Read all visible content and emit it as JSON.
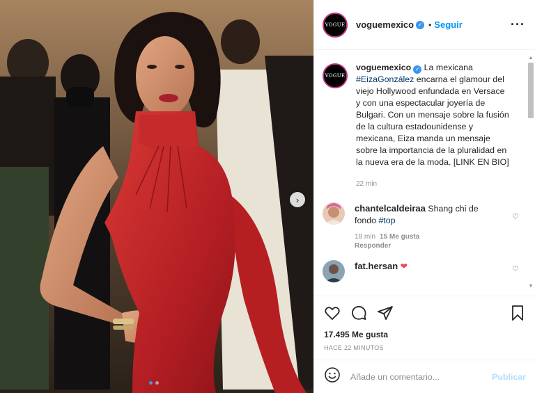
{
  "header": {
    "avatar_text": "VOGUE",
    "username": "voguemexico",
    "separator": "•",
    "follow_label": "Seguir",
    "more_label": "···"
  },
  "caption": {
    "username": "voguemexico",
    "text_before_tag": " La mexicana ",
    "tag": "#EizaGonzález",
    "text_after_tag": " encarna el glamour del viejo Hollywood enfundada en Versace y con una espectacular joyería de Bulgari. Con un mensaje sobre la fusión de la cultura estadounidense y mexicana, Eiza manda un mensaje sobre la importancia de la pluralidad en la nueva era de la moda. [LINK EN BIO]",
    "time": "22 min"
  },
  "comments": [
    {
      "username": "chantelcaldeiraa",
      "text": " Shang chi de fondo ",
      "tag": "#top",
      "time": "18 min",
      "likes": "15 Me gusta",
      "reply": "Responder"
    },
    {
      "username": "fat.hersan",
      "emoji": "❤"
    }
  ],
  "actions": {
    "likes": "17.495 Me gusta",
    "posted": "HACE 22 MINUTOS"
  },
  "add_comment": {
    "placeholder": "Añade un comentario...",
    "publish_label": "Publicar"
  },
  "carousel": {
    "next_label": "›",
    "slide_count": 2,
    "active_slide": 1
  },
  "colors": {
    "accent": "#0095f6",
    "dress": "#c62a2a",
    "like_red": "#ed4956",
    "publish_disabled": "#b2dffc"
  },
  "icons": [
    "heart-icon",
    "comment-icon",
    "share-icon",
    "bookmark-icon",
    "emoji-icon",
    "verified-icon",
    "more-icon",
    "chevron-right-icon"
  ]
}
